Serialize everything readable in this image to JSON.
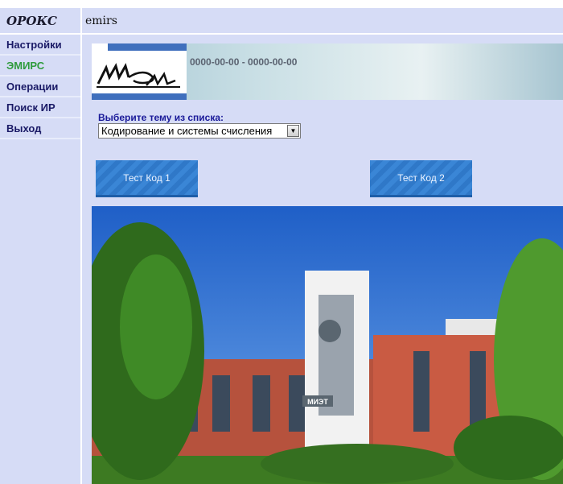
{
  "header": {
    "app_title": "ОРОКС",
    "context": "emirs"
  },
  "sidebar": {
    "items": [
      {
        "label": "Настройки",
        "active": false
      },
      {
        "label": "ЭМИРС",
        "active": true
      },
      {
        "label": "Операции",
        "active": false
      },
      {
        "label": "Поиск ИР",
        "active": false
      },
      {
        "label": "Выход",
        "active": false
      }
    ]
  },
  "banner": {
    "dates": "0000-00-00 - 0000-00-00",
    "logo_icon": "miet-logo"
  },
  "topic": {
    "label": "Выберите тему из списка:",
    "selected": "Кодирование и системы счисления"
  },
  "buttons": {
    "test1": "Тест Код 1",
    "test2": "Тест Код 2"
  },
  "photo": {
    "sign_text": "МИЭТ"
  },
  "colors": {
    "panel_bg": "#d6dcf6",
    "active_menu": "#2e9b3c",
    "menu_text": "#1a1a66",
    "button_blue": "#3a86d6"
  }
}
